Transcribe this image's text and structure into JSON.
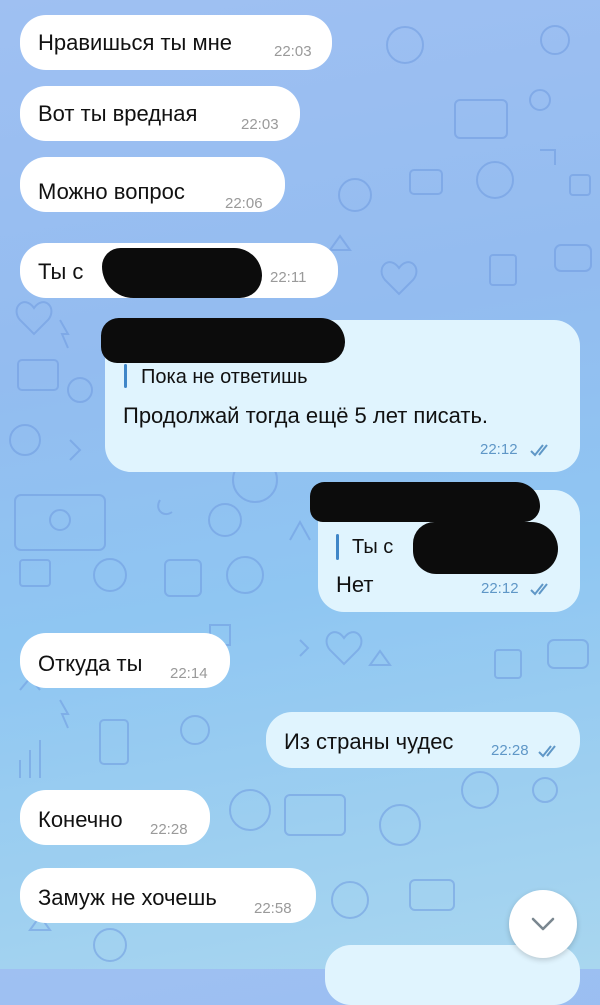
{
  "chat": {
    "colors": {
      "incoming_bubble": "#ffffff",
      "outgoing_bubble": "#e0f4fe",
      "time_incoming": "#9a9a9a",
      "time_outgoing": "#5f97c7",
      "quote_bar": "#3f86c8"
    },
    "messages": [
      {
        "text": "Нравишься ты мне",
        "time": "22:03",
        "direction": "incoming"
      },
      {
        "text": "Вот ты  вредная",
        "time": "22:03",
        "direction": "incoming"
      },
      {
        "text": "Можно вопрос",
        "time": "22:06",
        "direction": "incoming"
      },
      {
        "text": "Ты с",
        "time": "22:11",
        "direction": "incoming",
        "redacted": true
      },
      {
        "reply_quote": "Пока не ответишь",
        "text": "Продолжай тогда ещё 5 лет писать.",
        "time": "22:12",
        "direction": "outgoing",
        "status": "read"
      },
      {
        "reply_quote": "Ты с",
        "text": "Нет",
        "time": "22:12",
        "direction": "outgoing",
        "status": "read"
      },
      {
        "text": "Откуда ты",
        "time": "22:14",
        "direction": "incoming"
      },
      {
        "text": "Из страны чудес",
        "time": "22:28",
        "direction": "outgoing",
        "status": "read"
      },
      {
        "text": "Конечно",
        "time": "22:28",
        "direction": "incoming"
      },
      {
        "text": "Замуж не хочешь",
        "time": "22:58",
        "direction": "incoming"
      }
    ],
    "scroll_button_icon": "chevron-down-icon"
  }
}
